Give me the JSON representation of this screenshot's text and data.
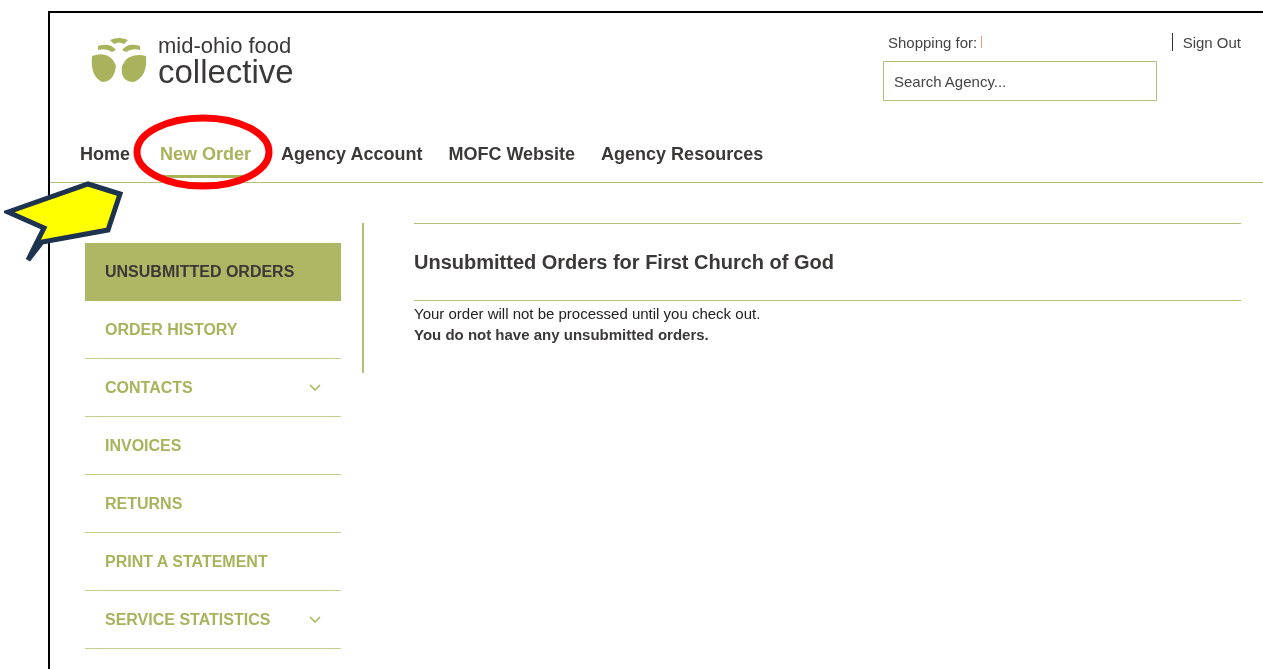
{
  "logo": {
    "line1": "mid-ohio food",
    "line2": "collective"
  },
  "header": {
    "shopping_for": "Shopping for:",
    "sign_out": "Sign Out",
    "search": {
      "placeholder": "Search Agency..."
    }
  },
  "nav": [
    {
      "label": "Home",
      "selected": false
    },
    {
      "label": "New Order",
      "selected": true
    },
    {
      "label": "Agency Account",
      "selected": false
    },
    {
      "label": "MOFC Website",
      "selected": false
    },
    {
      "label": "Agency Resources",
      "selected": false
    }
  ],
  "sidebar": {
    "items": [
      {
        "label": "UNSUBMITTED ORDERS",
        "selected": true,
        "expandable": false
      },
      {
        "label": "ORDER HISTORY",
        "selected": false,
        "expandable": false
      },
      {
        "label": "CONTACTS",
        "selected": false,
        "expandable": true
      },
      {
        "label": "INVOICES",
        "selected": false,
        "expandable": false
      },
      {
        "label": "RETURNS",
        "selected": false,
        "expandable": false
      },
      {
        "label": "PRINT A STATEMENT",
        "selected": false,
        "expandable": false
      },
      {
        "label": "SERVICE STATISTICS",
        "selected": false,
        "expandable": true
      }
    ]
  },
  "main": {
    "title": "Unsubmitted Orders for First Church of God",
    "note": "Your order will not be processed until you check out.",
    "message": "You do not have any unsubmitted orders."
  }
}
